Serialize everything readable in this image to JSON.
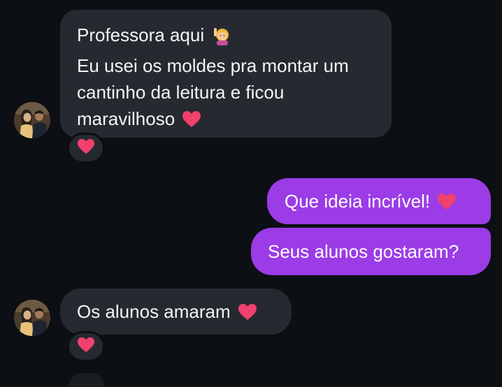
{
  "messages": {
    "incoming_1": {
      "lines": [
        "Professora aqui",
        "Eu usei os moldes pra montar um",
        "cantinho da leitura e ficou",
        "maravilhoso"
      ],
      "line1_emoji": "woman-raising-hand-emoji",
      "last_line_emoji": "heart-emoji",
      "reaction": "heart-emoji"
    },
    "outgoing_1": {
      "text": "Que ideia incrível!",
      "emoji": "heart-emoji"
    },
    "outgoing_2": {
      "text": "Seus alunos gostaram?"
    },
    "incoming_2": {
      "text": "Os alunos amaram",
      "emoji": "heart-emoji",
      "reaction": "heart-emoji"
    }
  },
  "colors": {
    "background": "#0c0f13",
    "incoming_bubble": "#262a30",
    "outgoing_bubble": "#9b3ce6",
    "heart": "#f0406e"
  }
}
